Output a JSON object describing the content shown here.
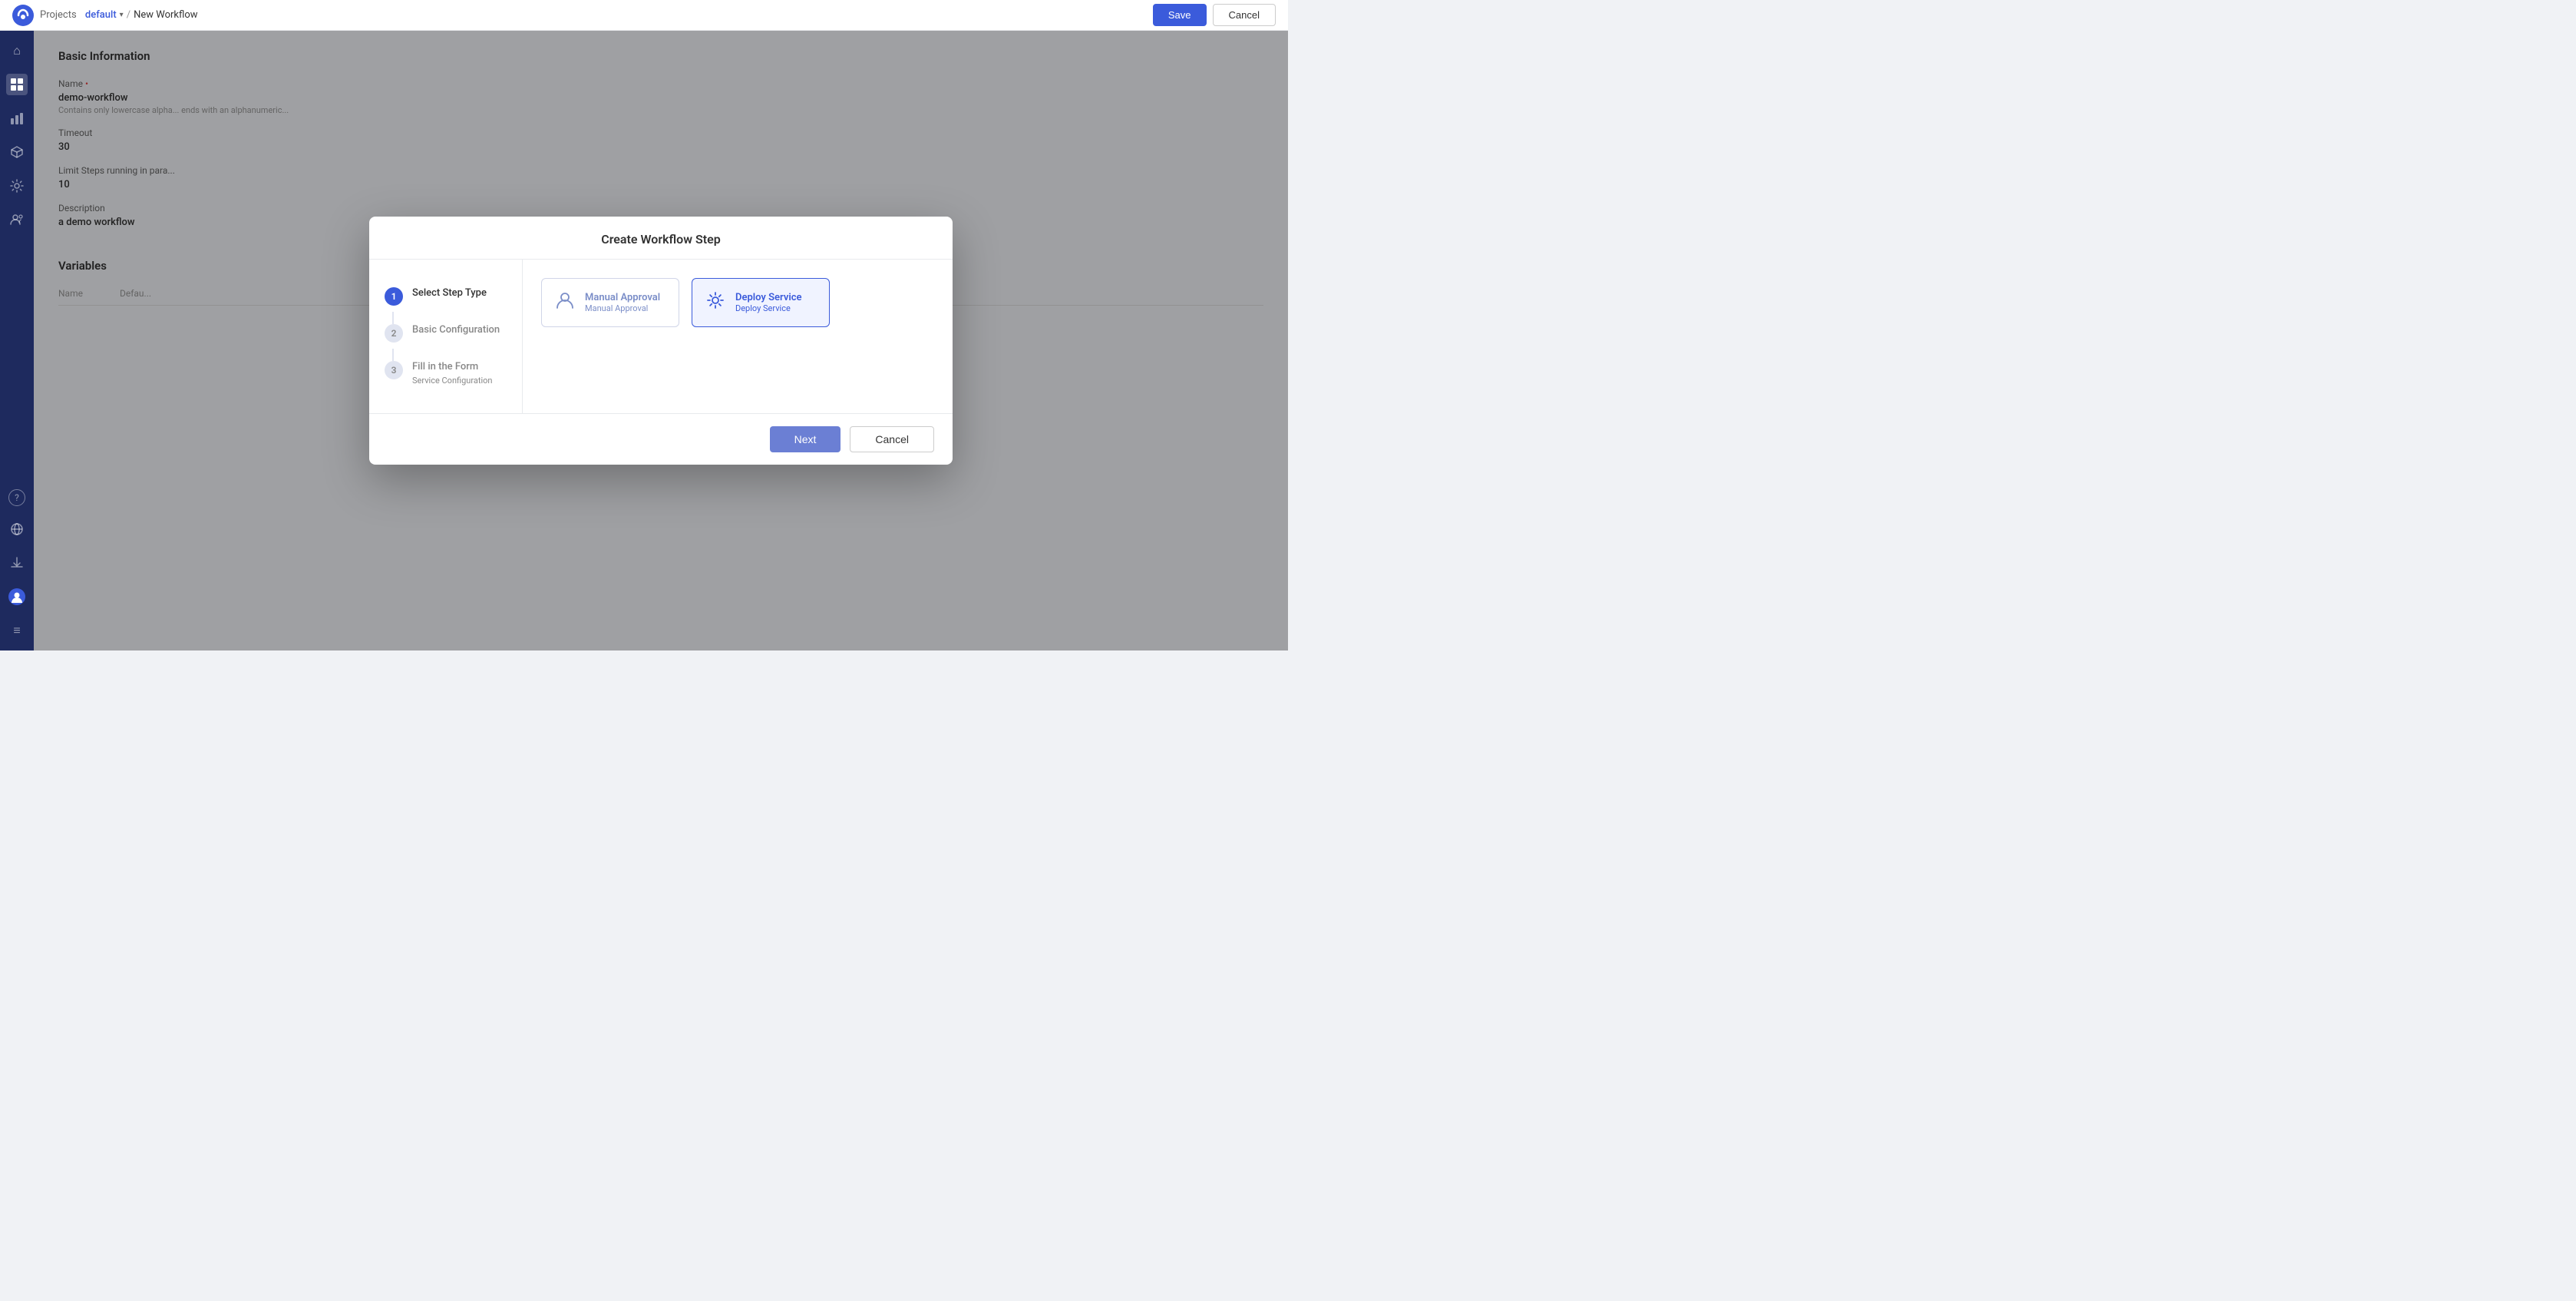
{
  "topNav": {
    "breadcrumb": {
      "section": "Projects",
      "project": "default",
      "separator": "/",
      "current": "New Workflow"
    },
    "saveLabel": "Save",
    "cancelLabel": "Cancel"
  },
  "sidebar": {
    "icons": [
      {
        "name": "home-icon",
        "symbol": "⌂",
        "active": false
      },
      {
        "name": "grid-icon",
        "symbol": "⊞",
        "active": true
      },
      {
        "name": "chart-icon",
        "symbol": "📊",
        "active": false
      },
      {
        "name": "package-icon",
        "symbol": "⬡",
        "active": false
      },
      {
        "name": "settings-icon",
        "symbol": "⚙",
        "active": false
      },
      {
        "name": "people-icon",
        "symbol": "👤",
        "active": false
      }
    ],
    "bottomIcons": [
      {
        "name": "help-icon",
        "symbol": "?",
        "active": false
      },
      {
        "name": "globe-icon",
        "symbol": "🌐",
        "active": false
      },
      {
        "name": "download-icon",
        "symbol": "↓",
        "active": false
      },
      {
        "name": "user-icon",
        "symbol": "👤",
        "active": false
      },
      {
        "name": "menu-icon",
        "symbol": "≡",
        "active": false
      }
    ]
  },
  "backgroundForm": {
    "sectionTitle": "Basic Information",
    "fields": [
      {
        "label": "Name",
        "required": true,
        "value": "demo-workflow",
        "hint": "Contains only lowercase alpha... ends with an alphanumeric..."
      },
      {
        "label": "Timeout",
        "required": false,
        "value": "30",
        "hint": ""
      },
      {
        "label": "Limit Steps running in para...",
        "required": false,
        "value": "10",
        "hint": ""
      },
      {
        "label": "Description",
        "required": false,
        "value": "a demo workflow",
        "hint": ""
      }
    ],
    "variablesTitle": "Variables",
    "variablesColumns": [
      "Name",
      "Defau..."
    ]
  },
  "modal": {
    "title": "Create Workflow Step",
    "steps": [
      {
        "number": "1",
        "label": "Select Step Type",
        "sublabel": "",
        "active": true
      },
      {
        "number": "2",
        "label": "Basic Configuration",
        "sublabel": "",
        "active": false
      },
      {
        "number": "3",
        "label": "Fill in the Form",
        "sublabel": "Service Configuration",
        "active": false
      }
    ],
    "typeCards": [
      {
        "id": "manual-approval",
        "title": "Manual Approval",
        "subtitle": "Manual Approval",
        "selected": false,
        "iconType": "person"
      },
      {
        "id": "deploy-service",
        "title": "Deploy Service",
        "subtitle": "Deploy Service",
        "selected": true,
        "iconType": "gear"
      }
    ],
    "nextLabel": "Next",
    "cancelLabel": "Cancel"
  }
}
